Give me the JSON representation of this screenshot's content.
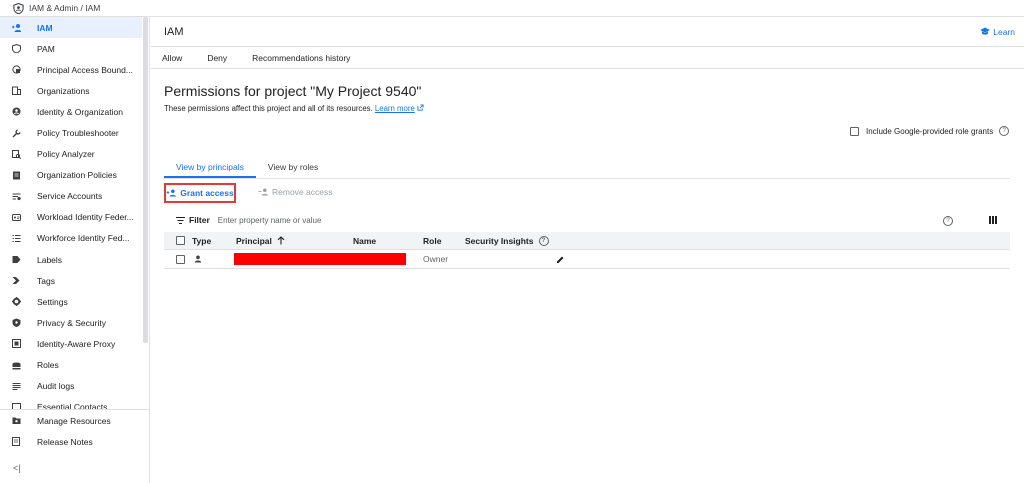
{
  "breadcrumb": {
    "text": "IAM & Admin  /  IAM"
  },
  "sidebar": {
    "items": [
      {
        "label": "IAM",
        "icon": "add-person-icon",
        "active": true
      },
      {
        "label": "PAM",
        "icon": "shield-icon"
      },
      {
        "label": "Principal Access Bound...",
        "icon": "boundary-icon"
      },
      {
        "label": "Organizations",
        "icon": "building-icon"
      },
      {
        "label": "Identity & Organization",
        "icon": "account-circle-icon"
      },
      {
        "label": "Policy Troubleshooter",
        "icon": "wrench-icon"
      },
      {
        "label": "Policy Analyzer",
        "icon": "policy-analyzer-icon"
      },
      {
        "label": "Organization Policies",
        "icon": "document-icon"
      },
      {
        "label": "Service Accounts",
        "icon": "service-account-icon"
      },
      {
        "label": "Workload Identity Feder...",
        "icon": "id-card-icon"
      },
      {
        "label": "Workforce Identity Fed...",
        "icon": "list-icon"
      },
      {
        "label": "Labels",
        "icon": "label-icon"
      },
      {
        "label": "Tags",
        "icon": "tag-icon"
      },
      {
        "label": "Settings",
        "icon": "gear-icon"
      },
      {
        "label": "Privacy & Security",
        "icon": "privacy-shield-icon"
      },
      {
        "label": "Identity-Aware Proxy",
        "icon": "proxy-icon"
      },
      {
        "label": "Roles",
        "icon": "roles-icon"
      },
      {
        "label": "Audit logs",
        "icon": "audit-icon"
      },
      {
        "label": "Essential Contacts",
        "icon": "contacts-icon"
      }
    ],
    "bottom": [
      {
        "label": "Manage Resources",
        "icon": "folder-icon"
      },
      {
        "label": "Release Notes",
        "icon": "notes-icon"
      }
    ],
    "collapse": "<|"
  },
  "header": {
    "title": "IAM",
    "learn": "Learn"
  },
  "top_tabs": [
    "Allow",
    "Deny",
    "Recommendations history"
  ],
  "page": {
    "title": "Permissions for project \"My Project 9540\"",
    "description": "These permissions affect this project and all of its resources.",
    "learn_more": "Learn more",
    "include_google": "Include Google-provided role grants"
  },
  "view_tabs": [
    {
      "label": "View by principals",
      "active": true
    },
    {
      "label": "View by roles",
      "active": false
    }
  ],
  "actions": {
    "grant": "Grant access",
    "remove": "Remove access"
  },
  "filter": {
    "label": "Filter",
    "placeholder": "Enter property name or value"
  },
  "table": {
    "headers": {
      "type": "Type",
      "principal": "Principal",
      "name": "Name",
      "role": "Role",
      "insights": "Security Insights"
    },
    "rows": [
      {
        "role": "Owner"
      }
    ]
  },
  "colors": {
    "accent": "#1a73e8",
    "highlight_box": "#e53935",
    "redaction": "#ff0000"
  }
}
